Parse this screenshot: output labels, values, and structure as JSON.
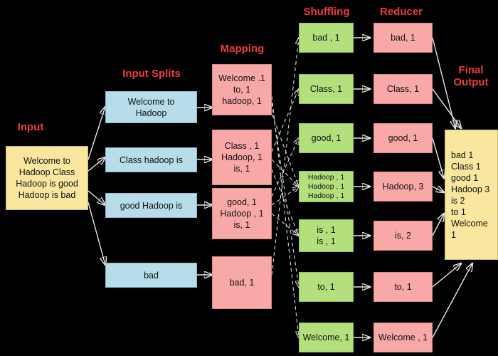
{
  "diagram": {
    "title": "MapReduce word count flow",
    "background": "#000000",
    "label_color": "#ef3b3b",
    "colors": {
      "input_yellow": "#f9e79f",
      "split_blue": "#b7dcea",
      "map_pink": "#f9a8a8",
      "shuffle_green": "#b3e07c",
      "arrow_white": "#e8e8e8"
    }
  },
  "stage_labels": {
    "input": "Input",
    "input_splits": "Input Splits",
    "mapping": "Mapping",
    "shuffling": "Shuffling",
    "reducer": "Reducer",
    "final_output": "Final\nOutput"
  },
  "input": {
    "text": "Welcome to\nHadoop Class\nHadoop is good\nHadoop is bad"
  },
  "input_splits": [
    {
      "text": "Welcome to\nHadoop"
    },
    {
      "text": "Class hadoop is"
    },
    {
      "text": "good Hadoop is"
    },
    {
      "text": "bad"
    }
  ],
  "mapping": [
    {
      "text": "Welcome .1\nto, 1\nhadoop, 1"
    },
    {
      "text": "Class , 1\nHadoop, 1\nis, 1"
    },
    {
      "text": "good, 1\nHadoop , 1\nis, 1"
    },
    {
      "text": "bad, 1"
    }
  ],
  "shuffling": [
    {
      "text": "bad , 1"
    },
    {
      "text": "Class, 1"
    },
    {
      "text": "good, 1"
    },
    {
      "text": "Hadoop , 1\nHadoop , 1\nHadoop , 1"
    },
    {
      "text": "is , 1\nis , 1"
    },
    {
      "text": "to, 1"
    },
    {
      "text": "Welcome, 1"
    }
  ],
  "reducer": [
    {
      "text": "bad, 1"
    },
    {
      "text": "Class, 1"
    },
    {
      "text": "good, 1"
    },
    {
      "text": "Hadoop, 3"
    },
    {
      "text": "is, 2"
    },
    {
      "text": "to, 1"
    },
    {
      "text": "Welcome , 1"
    }
  ],
  "final_output": {
    "text": "bad 1\nClass 1\ngood 1\nHadoop 3\nis 2\nto 1\nWelcome 1"
  }
}
